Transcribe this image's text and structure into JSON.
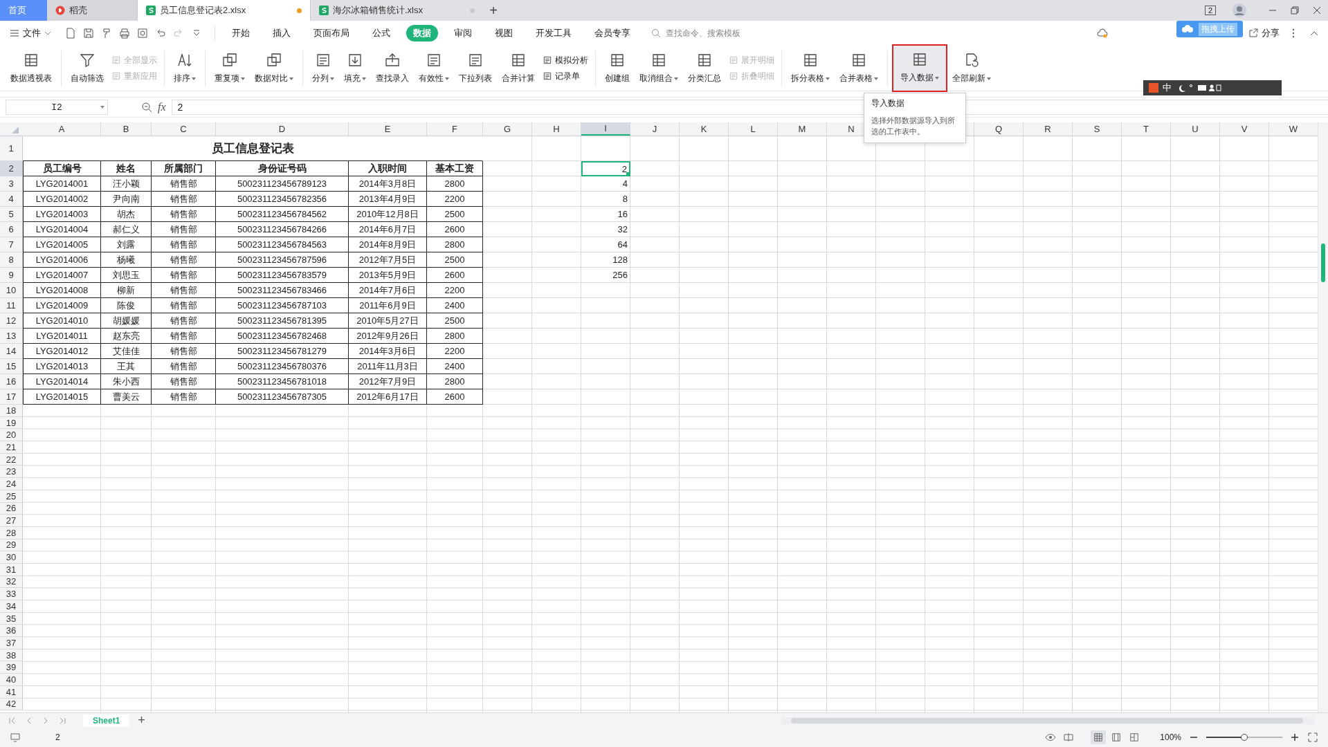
{
  "tabs": [
    {
      "label": "首页",
      "kind": "home",
      "selected": false
    },
    {
      "label": "稻壳",
      "kind": "docer",
      "selected": false
    },
    {
      "label": "员工信息登记表2.xlsx",
      "kind": "sheet",
      "selected": true,
      "modified": true
    },
    {
      "label": "海尔冰箱销售统计.xlsx",
      "kind": "sheet",
      "selected": false,
      "modified": false
    }
  ],
  "new_tab": "+",
  "header_badge": "2",
  "menu": {
    "file": "文件",
    "items": [
      {
        "label": "开始",
        "selected": false
      },
      {
        "label": "插入",
        "selected": false
      },
      {
        "label": "页面布局",
        "selected": false
      },
      {
        "label": "公式",
        "selected": false
      },
      {
        "label": "数据",
        "selected": true
      },
      {
        "label": "审阅",
        "selected": false
      },
      {
        "label": "视图",
        "selected": false
      },
      {
        "label": "开发工具",
        "selected": false
      },
      {
        "label": "会员专享",
        "selected": false
      }
    ],
    "search": {
      "placeholder": "查找命令、搜索模板"
    },
    "share": "分享"
  },
  "upload_widget": "拖拽上传",
  "ime_bar": {
    "mode": "中"
  },
  "ribbon": [
    [
      {
        "label": "数据透视表",
        "kind": "large",
        "dropdown": false,
        "hovered": false
      }
    ],
    [
      {
        "label": "自动筛选",
        "kind": "large",
        "dropdown": false,
        "hovered": false
      },
      {
        "kind": "stack",
        "items": [
          {
            "label": "全部显示",
            "disabled": true
          },
          {
            "label": "重新应用",
            "disabled": true
          }
        ]
      }
    ],
    [
      {
        "label": "排序",
        "kind": "large",
        "dropdown": true,
        "hovered": false
      }
    ],
    [
      {
        "label": "重复项",
        "kind": "large",
        "dropdown": true,
        "hovered": false
      },
      {
        "label": "数据对比",
        "kind": "large",
        "dropdown": true,
        "hovered": false
      }
    ],
    [
      {
        "label": "分列",
        "kind": "large",
        "dropdown": true,
        "hovered": false
      },
      {
        "label": "填充",
        "kind": "large",
        "dropdown": true,
        "hovered": false
      },
      {
        "label": "查找录入",
        "kind": "large",
        "dropdown": false,
        "hovered": false
      },
      {
        "label": "有效性",
        "kind": "large",
        "dropdown": true,
        "hovered": false
      },
      {
        "label": "下拉列表",
        "kind": "large",
        "dropdown": false,
        "hovered": false
      },
      {
        "label": "合并计算",
        "kind": "large",
        "dropdown": false,
        "hovered": false
      },
      {
        "kind": "stack",
        "items": [
          {
            "label": "模拟分析",
            "disabled": false
          },
          {
            "label": "记录单",
            "disabled": false
          }
        ]
      }
    ],
    [
      {
        "label": "创建组",
        "kind": "large",
        "dropdown": false,
        "hovered": false
      },
      {
        "label": "取消组合",
        "kind": "large",
        "dropdown": true,
        "hovered": false
      },
      {
        "label": "分类汇总",
        "kind": "large",
        "dropdown": false,
        "hovered": false
      },
      {
        "kind": "stack",
        "items": [
          {
            "label": "展开明细",
            "disabled": true
          },
          {
            "label": "折叠明细",
            "disabled": true
          }
        ]
      }
    ],
    [
      {
        "label": "拆分表格",
        "kind": "large",
        "dropdown": true,
        "hovered": false
      },
      {
        "label": "合并表格",
        "kind": "large",
        "dropdown": true,
        "hovered": false
      }
    ],
    [
      {
        "label": "导入数据",
        "kind": "large",
        "dropdown": true,
        "hovered": true
      },
      {
        "label": "全部刷新",
        "kind": "large",
        "dropdown": true,
        "hovered": false
      }
    ]
  ],
  "tooltip": {
    "title": "导入数据",
    "text": "选择外部数据源导入到所选的工作表中。"
  },
  "formula_bar": {
    "name_box": "I2",
    "fx": "fx",
    "value": "2"
  },
  "columns": [
    {
      "label": "A",
      "selected": false
    },
    {
      "label": "B",
      "selected": false
    },
    {
      "label": "C",
      "selected": false
    },
    {
      "label": "D",
      "selected": false
    },
    {
      "label": "E",
      "selected": false
    },
    {
      "label": "F",
      "selected": false
    },
    {
      "label": "G",
      "selected": false
    },
    {
      "label": "H",
      "selected": false
    },
    {
      "label": "I",
      "selected": true
    },
    {
      "label": "J",
      "selected": false
    },
    {
      "label": "K",
      "selected": false
    },
    {
      "label": "L",
      "selected": false
    },
    {
      "label": "M",
      "selected": false
    },
    {
      "label": "N",
      "selected": false
    }
  ],
  "columns_after_tooltip": [
    {
      "label": "Q",
      "selected": false
    },
    {
      "label": "R",
      "selected": false
    },
    {
      "label": "S",
      "selected": false
    },
    {
      "label": "T",
      "selected": false
    },
    {
      "label": "U",
      "selected": false
    },
    {
      "label": "V",
      "selected": false
    },
    {
      "label": "W",
      "selected": false
    }
  ],
  "row_numbers": [
    {
      "label": "1",
      "selected": false
    },
    {
      "label": "2",
      "selected": true
    },
    {
      "label": "3",
      "selected": false
    },
    {
      "label": "4",
      "selected": false
    },
    {
      "label": "5",
      "selected": false
    },
    {
      "label": "6",
      "selected": false
    },
    {
      "label": "7",
      "selected": false
    },
    {
      "label": "8",
      "selected": false
    },
    {
      "label": "9",
      "selected": false
    },
    {
      "label": "10",
      "selected": false
    },
    {
      "label": "11",
      "selected": false
    },
    {
      "label": "12",
      "selected": false
    },
    {
      "label": "13",
      "selected": false
    },
    {
      "label": "14",
      "selected": false
    },
    {
      "label": "15",
      "selected": false
    },
    {
      "label": "16",
      "selected": false
    },
    {
      "label": "17",
      "selected": false
    },
    {
      "label": "18",
      "selected": false
    },
    {
      "label": "19",
      "selected": false
    },
    {
      "label": "20",
      "selected": false
    },
    {
      "label": "21",
      "selected": false
    },
    {
      "label": "22",
      "selected": false
    },
    {
      "label": "23",
      "selected": false
    },
    {
      "label": "24",
      "selected": false
    },
    {
      "label": "25",
      "selected": false
    },
    {
      "label": "26",
      "selected": false
    },
    {
      "label": "27",
      "selected": false
    },
    {
      "label": "28",
      "selected": false
    },
    {
      "label": "29",
      "selected": false
    },
    {
      "label": "30",
      "selected": false
    },
    {
      "label": "31",
      "selected": false
    },
    {
      "label": "32",
      "selected": false
    },
    {
      "label": "33",
      "selected": false
    },
    {
      "label": "34",
      "selected": false
    },
    {
      "label": "35",
      "selected": false
    },
    {
      "label": "36",
      "selected": false
    },
    {
      "label": "37",
      "selected": false
    },
    {
      "label": "38",
      "selected": false
    },
    {
      "label": "39",
      "selected": false
    },
    {
      "label": "40",
      "selected": false
    },
    {
      "label": "41",
      "selected": false
    },
    {
      "label": "42",
      "selected": false
    }
  ],
  "sheet": {
    "title": "员工信息登记表",
    "header": [
      "员工编号",
      "姓名",
      "所属部门",
      "身份证号码",
      "入职时间",
      "基本工资"
    ],
    "records": [
      [
        "LYG2014001",
        "汪小颖",
        "销售部",
        "500231123456789123",
        "2014年3月8日",
        "2800"
      ],
      [
        "LYG2014002",
        "尹向南",
        "销售部",
        "500231123456782356",
        "2013年4月9日",
        "2200"
      ],
      [
        "LYG2014003",
        "胡杰",
        "销售部",
        "500231123456784562",
        "2010年12月8日",
        "2500"
      ],
      [
        "LYG2014004",
        "郝仁义",
        "销售部",
        "500231123456784266",
        "2014年6月7日",
        "2600"
      ],
      [
        "LYG2014005",
        "刘露",
        "销售部",
        "500231123456784563",
        "2014年8月9日",
        "2800"
      ],
      [
        "LYG2014006",
        "杨曦",
        "销售部",
        "500231123456787596",
        "2012年7月5日",
        "2500"
      ],
      [
        "LYG2014007",
        "刘思玉",
        "销售部",
        "500231123456783579",
        "2013年5月9日",
        "2600"
      ],
      [
        "LYG2014008",
        "柳新",
        "销售部",
        "500231123456783466",
        "2014年7月6日",
        "2200"
      ],
      [
        "LYG2014009",
        "陈俊",
        "销售部",
        "500231123456787103",
        "2011年6月9日",
        "2400"
      ],
      [
        "LYG2014010",
        "胡媛媛",
        "销售部",
        "500231123456781395",
        "2010年5月27日",
        "2500"
      ],
      [
        "LYG2014011",
        "赵东亮",
        "销售部",
        "500231123456782468",
        "2012年9月26日",
        "2800"
      ],
      [
        "LYG2014012",
        "艾佳佳",
        "销售部",
        "500231123456781279",
        "2014年3月6日",
        "2200"
      ],
      [
        "LYG2014013",
        "王其",
        "销售部",
        "500231123456780376",
        "2011年11月3日",
        "2400"
      ],
      [
        "LYG2014014",
        "朱小西",
        "销售部",
        "500231123456781018",
        "2012年7月9日",
        "2800"
      ],
      [
        "LYG2014015",
        "曹美云",
        "销售部",
        "500231123456787305",
        "2012年6月17日",
        "2600"
      ]
    ],
    "column_i": [
      {
        "value": "2",
        "active": true
      },
      {
        "value": "4",
        "active": false
      },
      {
        "value": "8",
        "active": false
      },
      {
        "value": "16",
        "active": false
      },
      {
        "value": "32",
        "active": false
      },
      {
        "value": "64",
        "active": false
      },
      {
        "value": "128",
        "active": false
      },
      {
        "value": "256",
        "active": false
      }
    ]
  },
  "sheet_tabs": [
    {
      "label": "Sheet1",
      "selected": true
    }
  ],
  "add_sheet": "+",
  "status_bar": {
    "value": "2",
    "view_modes": [
      {
        "selected": true
      },
      {
        "selected": false
      },
      {
        "selected": false
      }
    ],
    "zoom": "100%",
    "zoom_slider": {
      "level": 0.5
    }
  }
}
